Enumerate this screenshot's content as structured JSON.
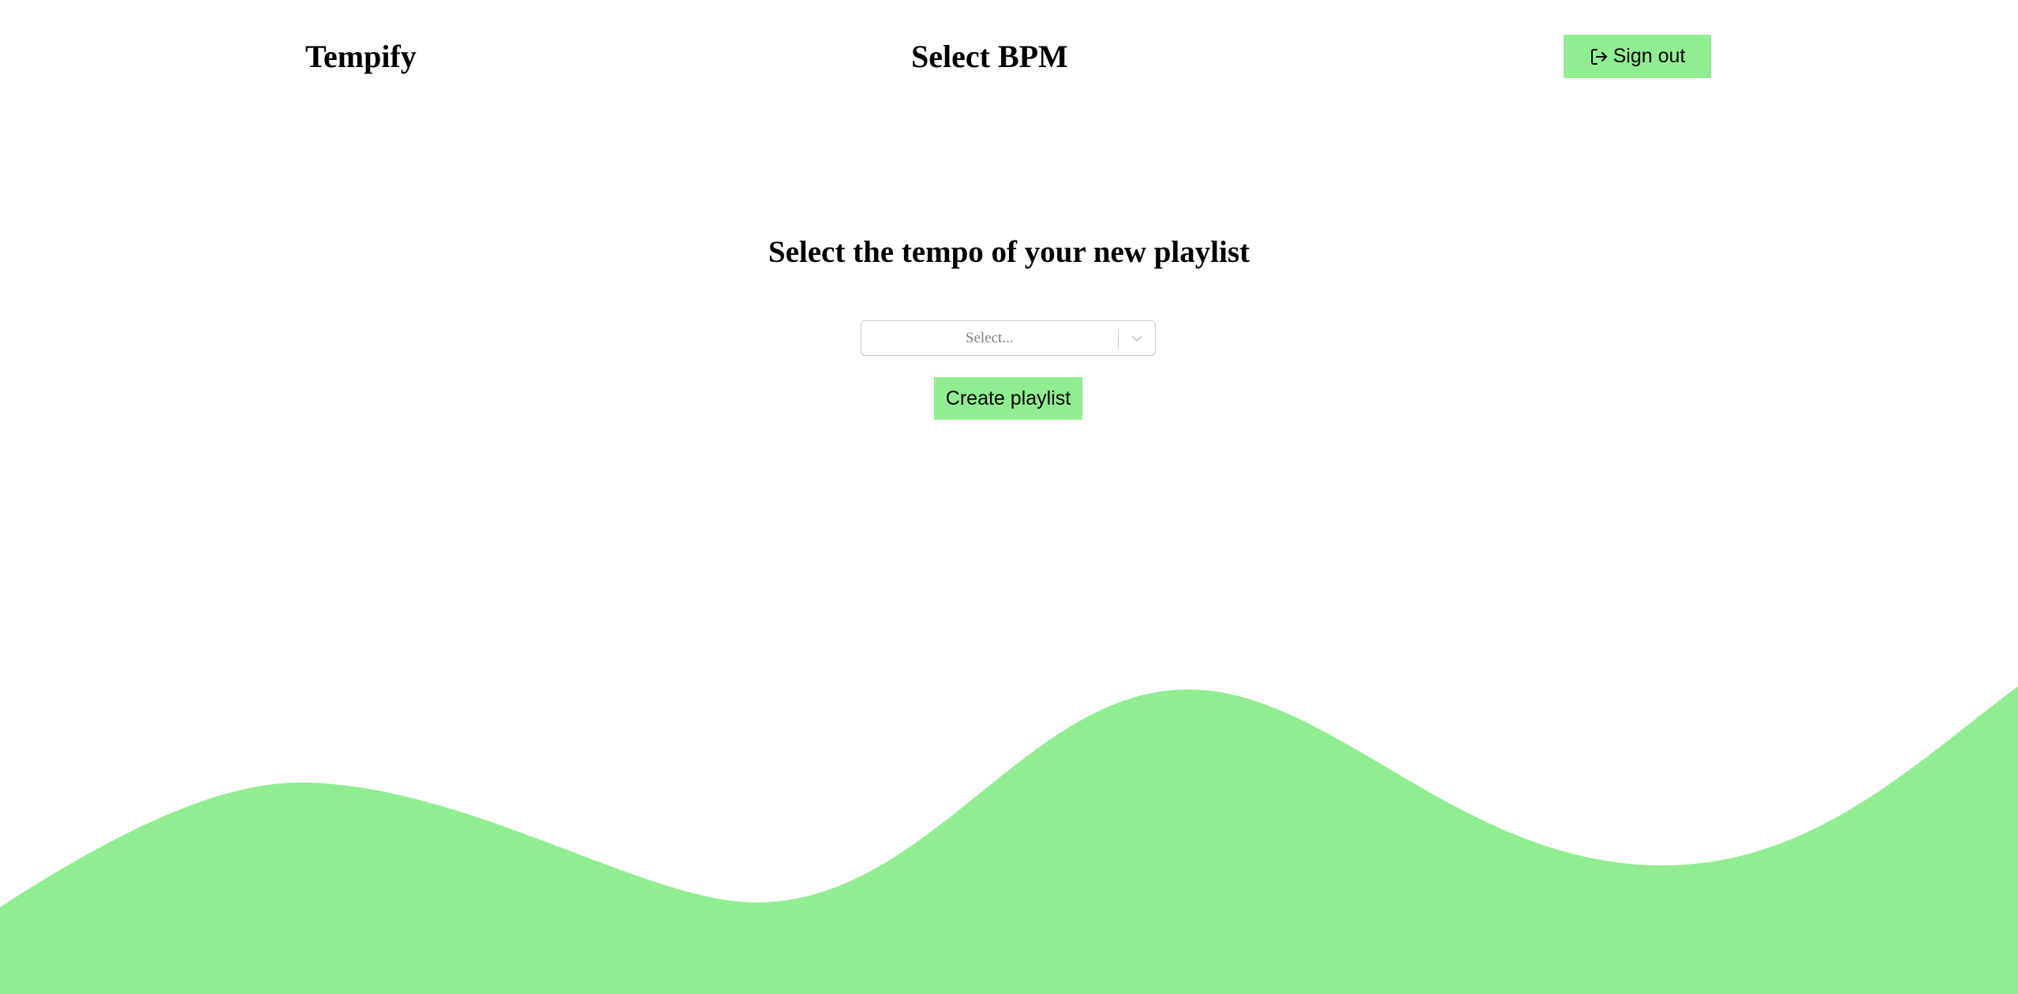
{
  "app": {
    "brand": "Tempify",
    "page_title": "Select BPM"
  },
  "header": {
    "signout_label": "Sign out",
    "signout_icon": "sign-out-icon"
  },
  "main": {
    "heading": "Select the tempo of your new playlist",
    "select": {
      "placeholder": "Select...",
      "icon": "chevron-down-icon"
    },
    "create_label": "Create playlist"
  },
  "colors": {
    "accent": "#90ee90",
    "background": "#ffffff",
    "select_border": "#cccccc",
    "placeholder_text": "#808080"
  }
}
